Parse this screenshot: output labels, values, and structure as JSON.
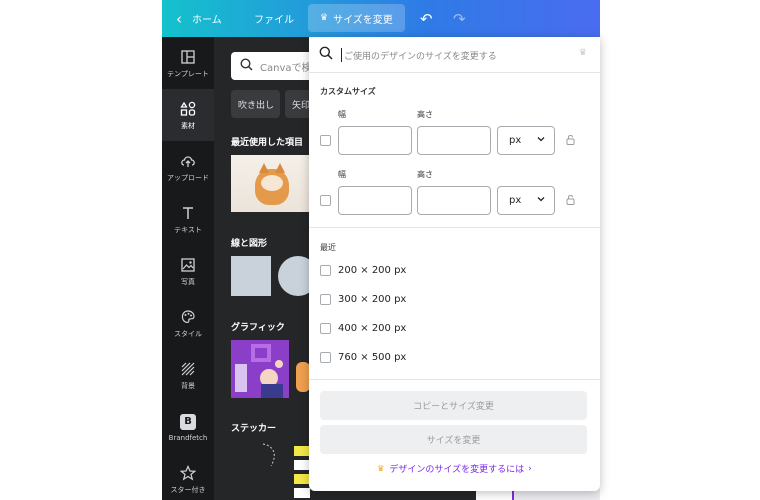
{
  "topbar": {
    "home_label": "ホーム",
    "file_label": "ファイル",
    "resize_label": "サイズを変更"
  },
  "rail": {
    "items": [
      {
        "label": "テンプレート",
        "icon": "template-icon"
      },
      {
        "label": "素材",
        "icon": "elements-icon"
      },
      {
        "label": "アップロード",
        "icon": "upload-icon"
      },
      {
        "label": "テキスト",
        "icon": "text-icon"
      },
      {
        "label": "写真",
        "icon": "photo-icon"
      },
      {
        "label": "スタイル",
        "icon": "palette-icon"
      },
      {
        "label": "背景",
        "icon": "background-icon"
      },
      {
        "label": "Brandfetch",
        "icon": "brandfetch-icon",
        "glyph": "B"
      },
      {
        "label": "スター付き",
        "icon": "star-icon"
      }
    ],
    "active": "素材"
  },
  "panel": {
    "search_placeholder": "Canvaで検索",
    "chips": [
      "吹き出し",
      "矢印"
    ],
    "sections": {
      "recent": "最近使用した項目",
      "shapes": "線と図形",
      "graphics": "グラフィック",
      "stickers": "ステッカー"
    }
  },
  "dropdown": {
    "search_placeholder": "ご使用のデザインのサイズを変更する",
    "custom_size_title": "カスタムサイズ",
    "rows": [
      {
        "width_label": "幅",
        "height_label": "高さ",
        "unit": "px"
      },
      {
        "width_label": "幅",
        "height_label": "高さ",
        "unit": "px"
      }
    ],
    "recent_title": "最近",
    "recent_items": [
      "200 × 200 px",
      "300 × 200 px",
      "400 × 200 px",
      "760 × 500 px"
    ],
    "copy_resize_button": "コピーとサイズ変更",
    "resize_button": "サイズを変更",
    "help_link": "デザインのサイズを変更するには"
  },
  "colors": {
    "topbar_start": "#14c2cc",
    "topbar_end": "#4a6cf0",
    "rail_bg": "#18191b",
    "panel_bg": "#252628",
    "accent": "#7d2ae8"
  }
}
